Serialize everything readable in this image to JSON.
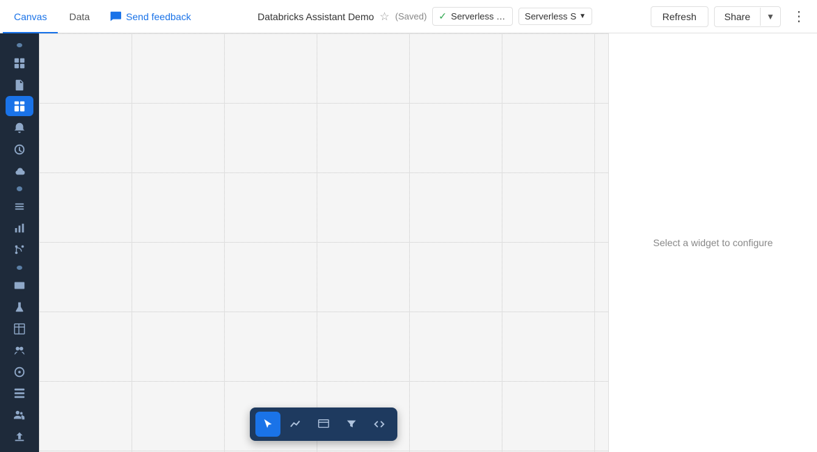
{
  "topbar": {
    "tab_canvas": "Canvas",
    "tab_data": "Data",
    "send_feedback": "Send feedback",
    "app_title": "Databricks Assistant Demo",
    "saved_status": "(Saved)",
    "cluster_status_icon": "✓",
    "cluster_name": "Serverless Sta...",
    "cluster_type": "Serverless",
    "cluster_size": "S",
    "refresh_label": "Refresh",
    "share_label": "Share",
    "active_tab": "canvas"
  },
  "sidebar": {
    "items": [
      {
        "name": "home",
        "icon": "⊞"
      },
      {
        "name": "file",
        "icon": "📄"
      },
      {
        "name": "dashboard",
        "icon": "▦"
      },
      {
        "name": "bell",
        "icon": "🔔"
      },
      {
        "name": "history",
        "icon": "🕐"
      },
      {
        "name": "cloud",
        "icon": "☁"
      },
      {
        "name": "list",
        "icon": "≡"
      },
      {
        "name": "chart",
        "icon": "📊"
      },
      {
        "name": "git",
        "icon": "⑂"
      },
      {
        "name": "tv",
        "icon": "📺"
      },
      {
        "name": "experiment",
        "icon": "⚗"
      },
      {
        "name": "table",
        "icon": "⊞"
      },
      {
        "name": "partners",
        "icon": "✕"
      },
      {
        "name": "ai",
        "icon": "◎"
      },
      {
        "name": "metrics",
        "icon": "⊟"
      },
      {
        "name": "users",
        "icon": "👥"
      },
      {
        "name": "export",
        "icon": "↗"
      }
    ]
  },
  "canvas": {
    "empty_message": "Select a widget to configure"
  },
  "toolbar": {
    "buttons": [
      {
        "name": "cursor",
        "icon": "cursor",
        "active": true
      },
      {
        "name": "chart",
        "icon": "chart"
      },
      {
        "name": "widget",
        "icon": "widget"
      },
      {
        "name": "filter",
        "icon": "filter"
      },
      {
        "name": "code",
        "icon": "code"
      }
    ]
  }
}
